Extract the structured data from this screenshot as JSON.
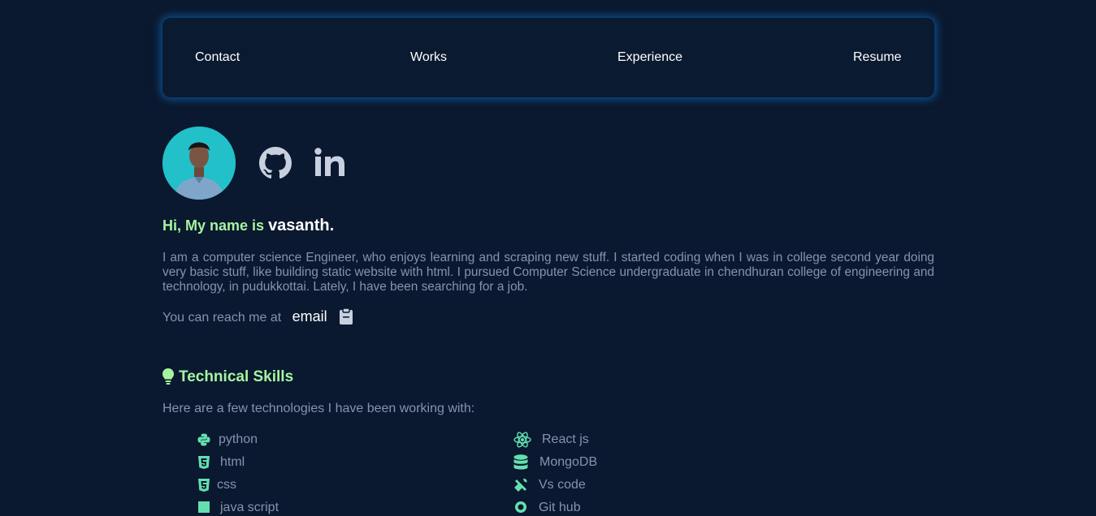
{
  "nav": {
    "items": [
      "Contact",
      "Works",
      "Experience",
      "Resume"
    ]
  },
  "profile": {
    "greeting": "Hi, My name is",
    "name": "vasanth.",
    "about": "I am a computer science Engineer, who enjoys learning and scraping new stuff. I started coding when I was in college second year doing very basic stuff, like building static website with html. I pursued Computer Science undergraduate in chendhuran college of engineering and technology, in pudukkottai. Lately, I have been searching for a job.",
    "reach_text": "You can reach me at",
    "email_label": "email"
  },
  "social": {
    "icons": [
      "github-icon",
      "linkedin-icon"
    ]
  },
  "skills": {
    "title": "Technical Skills",
    "intro": "Here are a few technologies I have been working with:",
    "left": [
      "python",
      "html",
      "css",
      "java script"
    ],
    "right": [
      "React js",
      "MongoDB",
      "Vs code",
      "Git hub"
    ]
  },
  "colors": {
    "background": "#0a192f",
    "accent": "#a6f3a0",
    "text": "#8892b0",
    "nav_glow": "#1178dc",
    "icon": "#64e0b0"
  }
}
